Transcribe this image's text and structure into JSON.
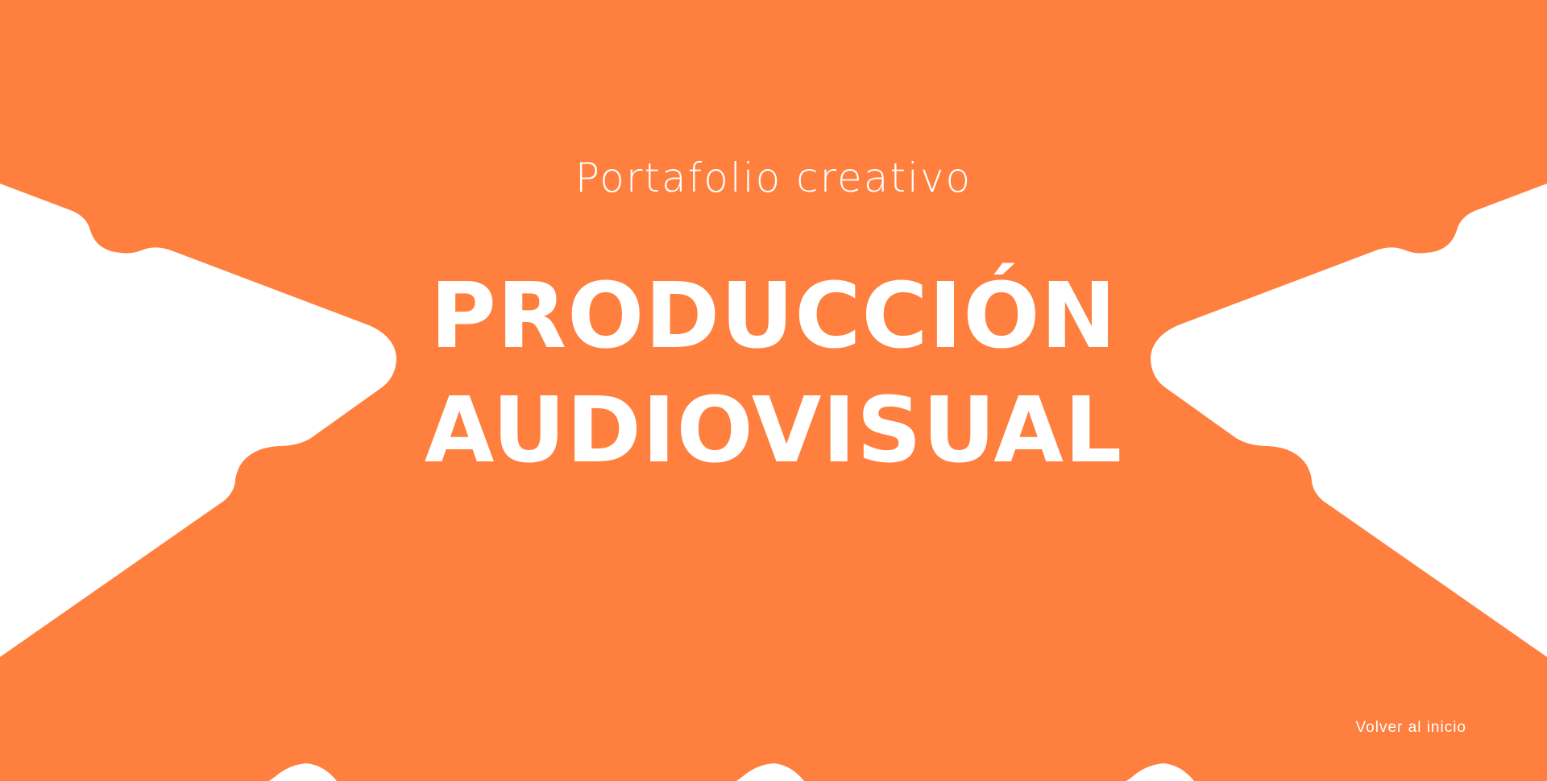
{
  "hero": {
    "subtitle": "Portafolio creativo",
    "title_line1": "PRODUCCIÓN",
    "title_line2": "AUDIOVISUAL"
  },
  "footer": {
    "back_link": "Volver al inicio"
  },
  "colors": {
    "accent": "#FF7F3F",
    "background": "#FFFFFF",
    "text": "#FFFFFF"
  }
}
